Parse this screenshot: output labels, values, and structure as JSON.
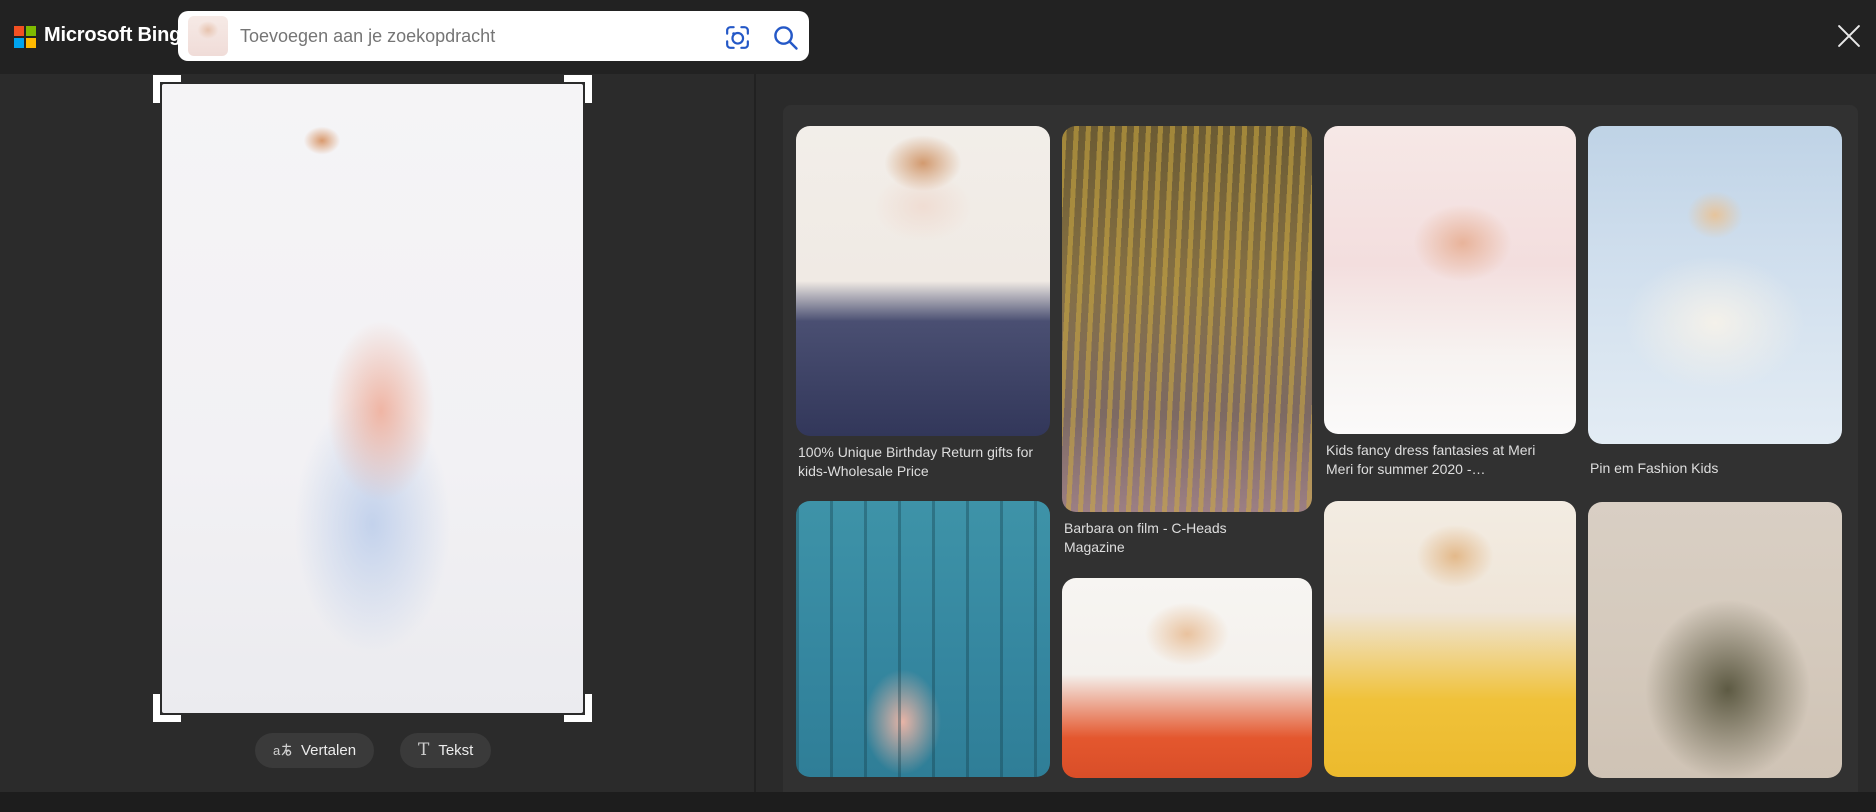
{
  "topbar": {
    "logo": {
      "text": "Microsoft Bing",
      "square_colors": {
        "red": "#f25022",
        "green": "#7fba00",
        "blue": "#00a4ef",
        "yellow": "#ffb900"
      }
    },
    "search": {
      "placeholder": "Toevoegen aan je zoekopdracht",
      "value": "",
      "icon_color": "#2458c7",
      "thumb_bg": "radial-gradient(14px 12px at 50% 35%, #e7c3ae, rgba(231,195,174,0) 75%), linear-gradient(180deg, #f6eae6, #f0dcd8)"
    }
  },
  "viewer": {
    "image_bg": "radial-gradient(26px 20px at 38% 9%, #d99a6e, rgba(217,154,110,0) 70%), radial-gradient(90px 150px at 52% 52%, #efb5a4, rgba(239,181,164,0) 60%), radial-gradient(120px 200px at 50% 70%, #c3d2ec, rgba(195,210,236,0) 65%), linear-gradient(180deg, #f5f4f6 0%, #f2f1f4 60%, #ebebef 100%)",
    "translate_label": "Vertalen",
    "text_label": "Tekst",
    "text_icon_glyph": "T"
  },
  "related": {
    "cards": [
      {
        "caption": "100% Unique Birthday Return gifts for kids-Wholesale Price",
        "bg": "radial-gradient(55px 40px at 50% 12%, #d29a6f, rgba(210,154,111,0) 70%), radial-gradient(70px 50px at 50% 26%, #f0ddd3, rgba(240,221,211,0) 70%), linear-gradient(180deg, #f2eee9 0%, #f0eae4 50%, #4a4f72 63%, #32375a 100%)"
      },
      {
        "caption": "Barbara on film - C-Heads Magazine",
        "bg": "repeating-linear-gradient(93deg, rgba(206,170,64,0.55) 0 5px, rgba(0,0,0,0) 5px 12px), linear-gradient(180deg, #6b5b33 0%, #857044 40%, #7d6a63 75%, #9c7f84 100%)"
      },
      {
        "caption": "Kids fancy dress fantasies at Meri Meri for summer 2020 -…",
        "bg": "radial-gradient(70px 55px at 55% 38%, #e8b39a, rgba(232,179,154,0) 70%), linear-gradient(180deg, #f6e8e6 0%, #f3dede 45%, #f7f3f1 75%, #fbfafa 100%)"
      },
      {
        "caption": "Pin em Fashion Kids",
        "bg": "radial-gradient(120px 90px at 50% 62%, #f4f1ea, rgba(244,241,234,0) 75%), radial-gradient(40px 34px at 50% 28%, #e6c49c, rgba(230,196,156,0) 70%), linear-gradient(180deg, #bfd3e6 0%, #cfdeed 40%, #e3ecf4 100%)"
      },
      {
        "caption": "",
        "bg": "repeating-linear-gradient(90deg, rgba(18,58,70,0.35) 0 3px, rgba(0,0,0,0) 3px 34px), radial-gradient(55px 75px at 42% 80%, #e8b4a6, rgba(232,180,166,0) 70%), linear-gradient(180deg, #3e93a8 0%, #3587a0 55%, #2f7e97 100%)"
      },
      {
        "caption": "",
        "bg": "radial-gradient(60px 45px at 50% 28%, #e9c29e, rgba(233,194,158,0) 70%), linear-gradient(180deg, #f7f5f2 0%, #f4f1ed 48%, #e4572e 80%, #d94e28 100%)"
      },
      {
        "caption": "",
        "bg": "radial-gradient(55px 45px at 52% 20%, #e3b98a, rgba(227,185,138,0) 70%), linear-gradient(180deg, #f3ece2 0%, #efe5d8 40%, #f0c23a 72%, #ecba2d 100%)"
      },
      {
        "caption": "",
        "bg": "radial-gradient(110px 120px at 55% 68%, #5d5a43, rgba(93,90,67,0) 75%), linear-gradient(180deg, #d9cfc4 0%, #d5cabd 50%, #cfc3b5 100%)"
      }
    ]
  }
}
